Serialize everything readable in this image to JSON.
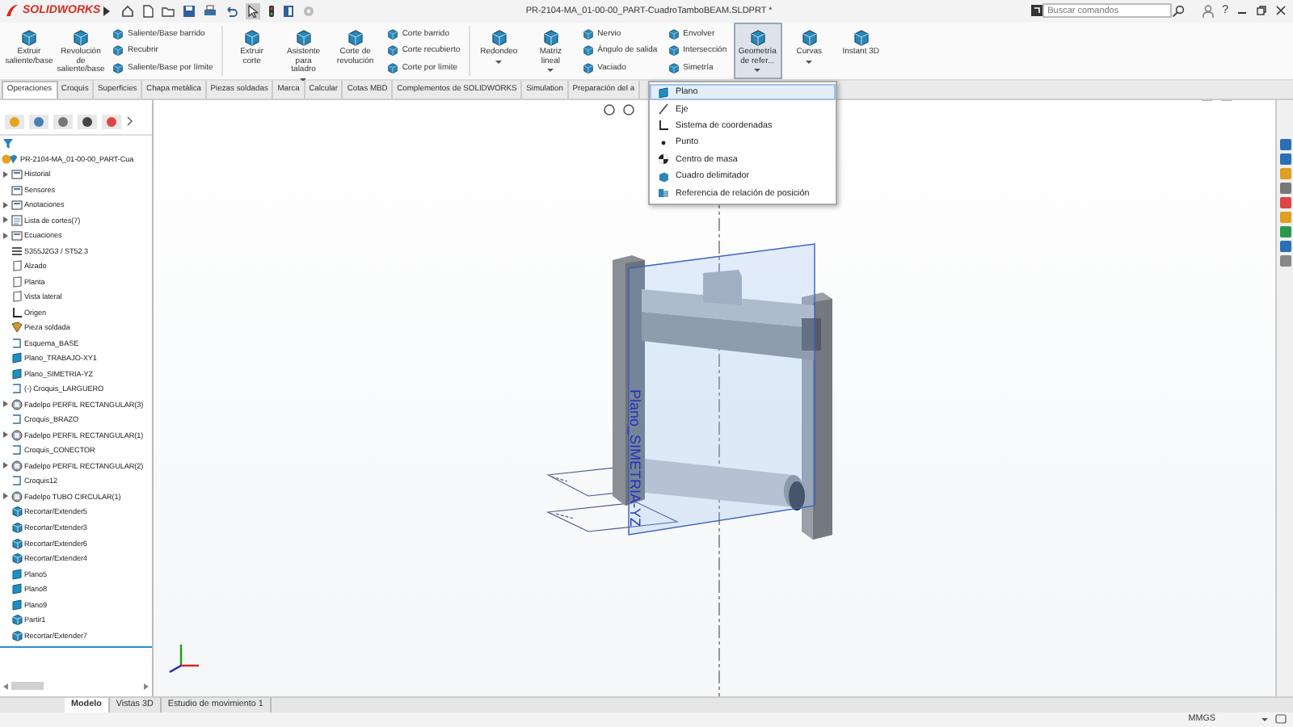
{
  "title_bar": {
    "logo": "SOLIDWORKS",
    "title": "PR-2104-MA_01-00-00_PART-CuadroTamboBEAM.SLDPRT *",
    "search": {
      "placeholder": "Buscar comandos"
    },
    "help": "?"
  },
  "ribbon": [
    {
      "kind": "large",
      "label": "Extruir saliente/base",
      "dropdown": false,
      "selected": false
    },
    {
      "kind": "large",
      "label": "Revolución de saliente/base",
      "dropdown": false,
      "selected": false
    },
    {
      "kind": "column",
      "items": [
        "Saliente/Base barrido",
        "Recubrir",
        "Saliente/Base por límite"
      ]
    },
    {
      "kind": "separator"
    },
    {
      "kind": "large",
      "label": "Extruir corte",
      "dropdown": false,
      "selected": false
    },
    {
      "kind": "large",
      "label": "Asistente para taladro",
      "dropdown": true,
      "selected": false
    },
    {
      "kind": "large",
      "label": "Corte de revolución",
      "dropdown": false,
      "selected": false
    },
    {
      "kind": "column",
      "items": [
        "Corte barrido",
        "Corte recubierto",
        "Corte por límite"
      ]
    },
    {
      "kind": "separator"
    },
    {
      "kind": "large",
      "label": "Redondeo",
      "dropdown": true,
      "selected": false
    },
    {
      "kind": "large",
      "label": "Matriz lineal",
      "dropdown": true,
      "selected": false
    },
    {
      "kind": "column",
      "items": [
        "Nervio",
        "Ángulo de salida",
        "Vaciado"
      ]
    },
    {
      "kind": "column",
      "items": [
        "Envolver",
        "Intersección",
        "Simetría"
      ]
    },
    {
      "kind": "large",
      "label": "Geometría de refer...",
      "dropdown": true,
      "selected": true
    },
    {
      "kind": "large",
      "label": "Curvas",
      "dropdown": true,
      "selected": false
    },
    {
      "kind": "large",
      "label": "Instant 3D",
      "dropdown": false,
      "selected": false
    }
  ],
  "tabs": [
    {
      "label": "Operaciones",
      "selected": true
    },
    {
      "label": "Croquis",
      "selected": false
    },
    {
      "label": "Superficies",
      "selected": false
    },
    {
      "label": "Chapa metálica",
      "selected": false
    },
    {
      "label": "Piezas soldadas",
      "selected": false
    },
    {
      "label": "Marca",
      "selected": false
    },
    {
      "label": "Calcular",
      "selected": false
    },
    {
      "label": "Cotas MBD",
      "selected": false
    },
    {
      "label": "Complementos de SOLIDWORKS",
      "selected": false
    },
    {
      "label": "Simulation",
      "selected": false
    },
    {
      "label": "Preparación del a",
      "selected": false
    }
  ],
  "panel": {
    "root": "PR-2104-MA_01-00-00_PART-Cua",
    "tree": [
      {
        "label": "Historial",
        "kind": "folder",
        "collapsed": true
      },
      {
        "label": "Sensores",
        "kind": "folder",
        "collapsed": false
      },
      {
        "label": "Anotaciones",
        "kind": "folder",
        "collapsed": true
      },
      {
        "label": "Lista de cortes(7)",
        "kind": "list",
        "collapsed": true
      },
      {
        "label": "Ecuaciones",
        "kind": "folder",
        "collapsed": true
      },
      {
        "label": "S355J2G3 / ST52.3",
        "kind": "material",
        "collapsed": false
      },
      {
        "label": "Alzado",
        "kind": "plane",
        "collapsed": false
      },
      {
        "label": "Planta",
        "kind": "plane",
        "collapsed": false
      },
      {
        "label": "Vista lateral",
        "kind": "plane",
        "collapsed": false
      },
      {
        "label": "Origen",
        "kind": "origin",
        "collapsed": false
      },
      {
        "label": "Pieza soldada",
        "kind": "weldment",
        "collapsed": false
      },
      {
        "label": "Esquema_BASE",
        "kind": "sketch",
        "collapsed": false
      },
      {
        "label": "Plano_TRABAJO-XY1",
        "kind": "refplane",
        "collapsed": false
      },
      {
        "label": "Plano_SIMETRIA-YZ",
        "kind": "refplane",
        "collapsed": false
      },
      {
        "label": "(-) Croquis_LARGUERO",
        "kind": "sketch",
        "collapsed": false
      },
      {
        "label": "Fadelpo PERFIL RECTANGULAR(3)",
        "kind": "profile",
        "collapsed": true
      },
      {
        "label": "Croquis_BRAZO",
        "kind": "sketch",
        "collapsed": false
      },
      {
        "label": "Fadelpo PERFIL RECTANGULAR(1)",
        "kind": "profile",
        "collapsed": true
      },
      {
        "label": "Croquis_CONECTOR",
        "kind": "sketch",
        "collapsed": false
      },
      {
        "label": "Fadelpo PERFIL RECTANGULAR(2)",
        "kind": "profile",
        "collapsed": true
      },
      {
        "label": "Croquis12",
        "kind": "sketch",
        "collapsed": false
      },
      {
        "label": "Fadelpo TUBO CIRCULAR(1)",
        "kind": "profile",
        "collapsed": true
      },
      {
        "label": "Recortar/Extender5",
        "kind": "trim",
        "collapsed": false
      },
      {
        "label": "Recortar/Extender3",
        "kind": "trim",
        "collapsed": false
      },
      {
        "label": "Recortar/Extender6",
        "kind": "trim",
        "collapsed": false
      },
      {
        "label": "Recortar/Extender4",
        "kind": "trim",
        "collapsed": false
      },
      {
        "label": "Plano5",
        "kind": "refplane",
        "collapsed": false
      },
      {
        "label": "Plano8",
        "kind": "refplane",
        "collapsed": false
      },
      {
        "label": "Plano9",
        "kind": "refplane",
        "collapsed": false
      },
      {
        "label": "Partir1",
        "kind": "trim",
        "collapsed": false
      },
      {
        "label": "Recortar/Extender7",
        "kind": "trim",
        "collapsed": false
      }
    ]
  },
  "viewport": {
    "plane_label": "Plano_SIMETRIA-YZ"
  },
  "menu": [
    {
      "label": "Plano",
      "kind": "refplane",
      "selected": true
    },
    {
      "label": "Eje",
      "kind": "axis",
      "selected": false
    },
    {
      "label": "Sistema de coordenadas",
      "kind": "origin",
      "selected": false
    },
    {
      "label": "Punto",
      "kind": "point",
      "selected": false
    },
    {
      "label": "Centro de masa",
      "kind": "mass",
      "selected": false
    },
    {
      "label": "Cuadro delimitador",
      "kind": "box",
      "selected": false
    },
    {
      "label": "Referencia de relación de posición",
      "kind": "mate",
      "selected": false
    }
  ],
  "bottom_tabs": [
    {
      "label": "Modelo",
      "selected": true
    },
    {
      "label": "Vistas 3D",
      "selected": false
    },
    {
      "label": "Estudio de movimiento 1",
      "selected": false
    }
  ],
  "status_bar": {
    "units": "MMGS"
  }
}
